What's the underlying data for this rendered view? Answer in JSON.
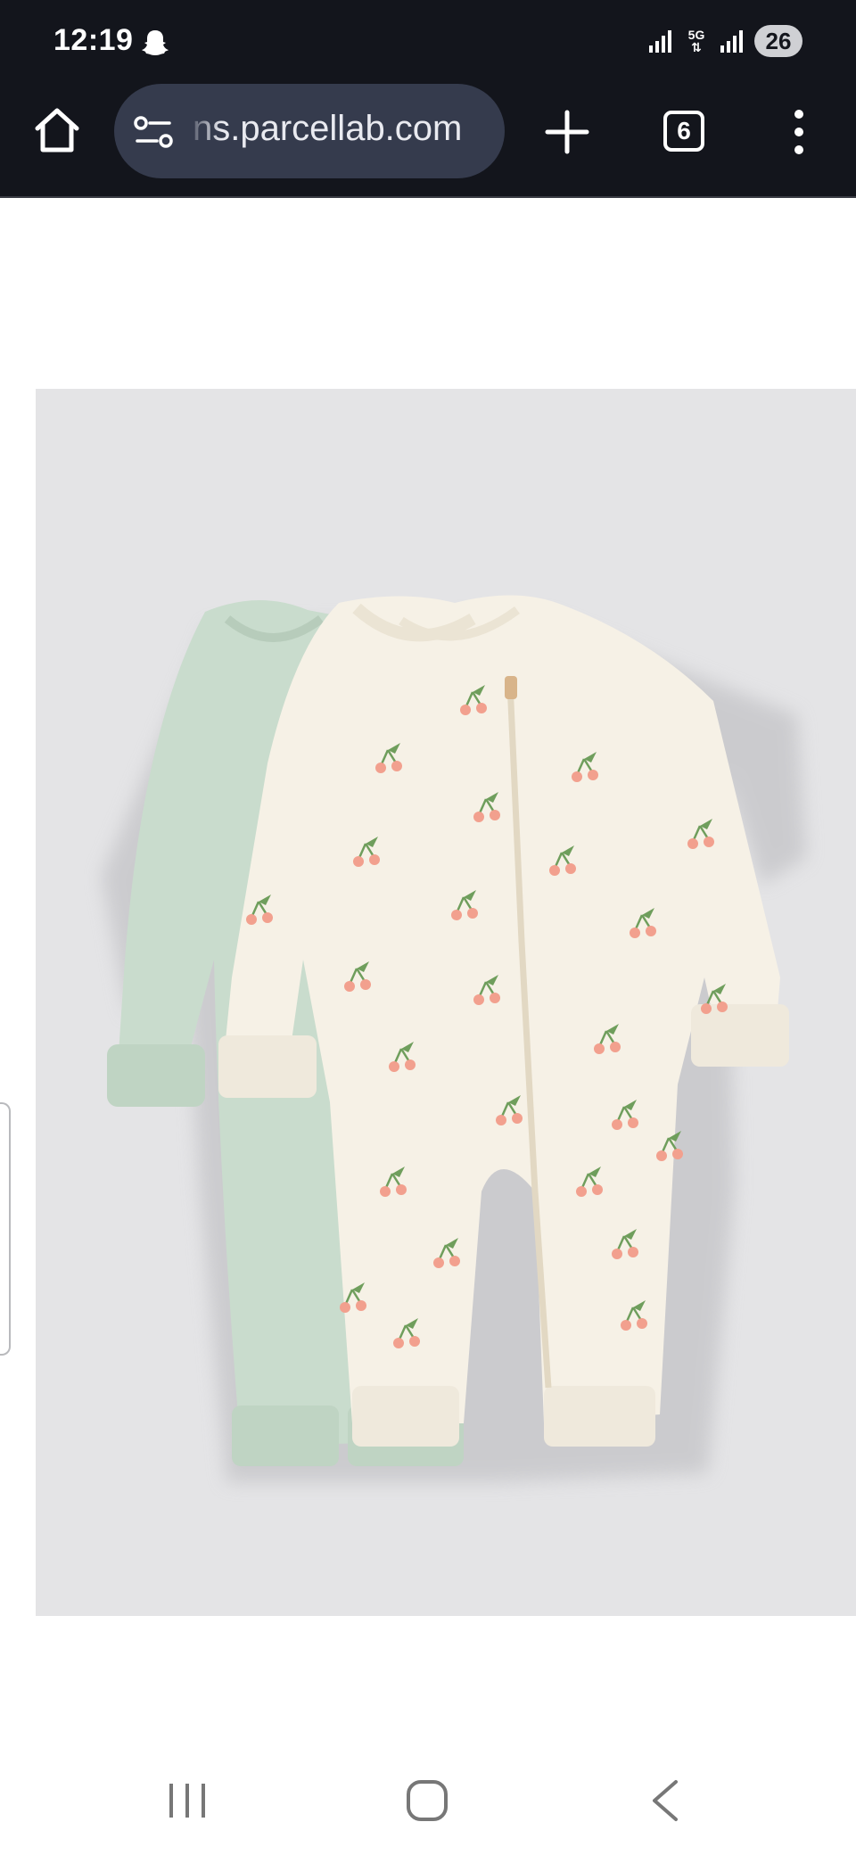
{
  "status_bar": {
    "time": "12:19",
    "network_badge": "5G",
    "battery": "26",
    "icons": [
      "snapchat-icon",
      "signal-icon",
      "5g-icon",
      "signal-icon",
      "battery-icon"
    ]
  },
  "browser": {
    "url": "ns.parcellab.com",
    "tab_count": "6",
    "icons": [
      "home-icon",
      "site-settings-icon",
      "plus-icon",
      "tabs-icon",
      "more-vert-icon"
    ]
  },
  "product": {
    "image": "two baby sleepsuits: mint green and cream with cherry print",
    "colors": {
      "background": "#e4e4e6",
      "mint": "#c9dccd",
      "cream": "#f6f1e6",
      "cherry": "#f2a08e",
      "leaf": "#6f9e5c"
    }
  },
  "navbar": {
    "icons": [
      "recents-icon",
      "home-icon",
      "back-icon"
    ]
  }
}
